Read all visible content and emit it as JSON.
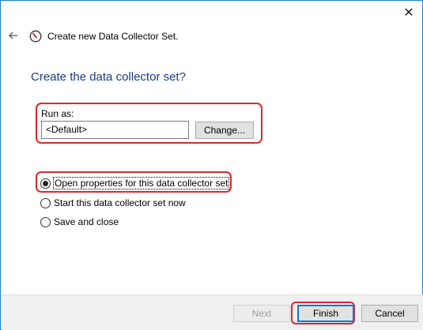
{
  "header": {
    "title": "Create new Data Collector Set.",
    "back_icon": "back-arrow-icon",
    "app_icon": "performance-gauge-icon",
    "close_icon": "close-icon"
  },
  "main": {
    "heading": "Create the data collector set?",
    "run_as": {
      "label": "Run as:",
      "value": "<Default>",
      "change_button": "Change..."
    },
    "options": [
      {
        "label": "Open properties for this data collector set",
        "checked": true
      },
      {
        "label": "Start this data collector set now",
        "checked": false
      },
      {
        "label": "Save and close",
        "checked": false
      }
    ]
  },
  "footer": {
    "next_label": "Next",
    "finish_label": "Finish",
    "cancel_label": "Cancel"
  },
  "colors": {
    "heading": "#1a3b8f",
    "highlight": "#e0262e",
    "window_border": "#1883d7"
  }
}
